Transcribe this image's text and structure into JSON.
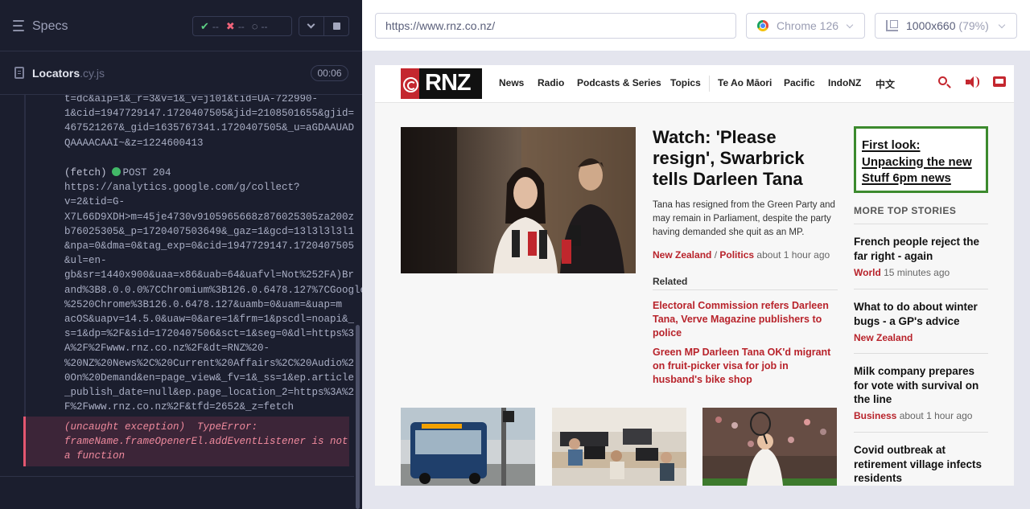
{
  "runner": {
    "title": "Specs",
    "stats": {
      "passed": "--",
      "failed": "--",
      "pending": "--"
    },
    "spec": {
      "name": "Locators",
      "ext": ".cy.js",
      "duration": "00:06"
    },
    "log_top": "t=dc&aip=1&_r=3&v=1&_v=j101&tid=UA-722990-\n1&cid=1947729147.1720407505&jid=2108501655&gjid=\n467521267&_gid=1635767341.1720407505&_u=aGDAAUAD\nQAAAACAAI~&z=1224600413",
    "fetch_tag": "(fetch)",
    "fetch_status": "POST 204",
    "fetch_url": "https://analytics.google.com/g/collect?\nv=2&tid=G-\nX7L66D9XDH>m=45je4730v9105965668z876025305za200z\nb76025305&_p=1720407503649&_gaz=1&gcd=13l3l3l3l1\n&npa=0&dma=0&tag_exp=0&cid=1947729147.1720407505\n&ul=en-\ngb&sr=1440x900&uaa=x86&uab=64&uafvl=Not%252FA)Br\nand%3B8.0.0.0%7CChromium%3B126.0.6478.127%7CGoogle\n%2520Chrome%3B126.0.6478.127&uamb=0&uam=&uap=m\nacOS&uapv=14.5.0&uaw=0&are=1&frm=1&pscdl=noapi&_\ns=1&dp=%2F&sid=1720407506&sct=1&seg=0&dl=https%3\nA%2F%2Fwww.rnz.co.nz%2F&dt=RNZ%20-\n%20NZ%20News%2C%20Current%20Affairs%2C%20Audio%2\n0On%20Demand&en=page_view&_fv=1&_ss=1&ep.article\n_publish_date=null&ep.page_location_2=https%3A%2\nF%2Fwww.rnz.co.nz%2F&tfd=2652&_z=fetch",
    "error": "(uncaught exception)  TypeError:\nframeName.frameOpenerEl.addEventListener is not\na function"
  },
  "aut": {
    "url": "https://www.rnz.co.nz/",
    "browser": "Chrome 126",
    "viewport": "1000x660",
    "zoom": "(79%)"
  },
  "site": {
    "logo": "RNZ",
    "nav": [
      "News",
      "Radio",
      "Podcasts & Series",
      "Topics",
      "Te Ao Māori",
      "Pacific",
      "IndoNZ",
      "中文"
    ],
    "lead": {
      "headline": "Watch: 'Please resign', Swarbrick tells Darleen Tana",
      "standfirst": "Tana has resigned from the Green Party and may remain in Parliament, despite the party having demanded she quit as an MP.",
      "section": "New Zealand",
      "sep": "/",
      "topic": "Politics",
      "ago": "about 1 hour ago",
      "related_label": "Related",
      "related": [
        "Electoral Commission refers Darleen Tana, Verve Magazine publishers to police",
        "Green MP Darleen Tana OK'd migrant on fruit-picker visa for job in husband's bike shop"
      ]
    },
    "first_look": "First look: Unpacking the new Stuff 6pm news",
    "more_top": "MORE TOP STORIES",
    "side": [
      {
        "title": "French people reject the far right - again",
        "section": "World",
        "ago": "15 minutes ago"
      },
      {
        "title": "What to do about winter bugs - a GP's advice",
        "section": "New Zealand",
        "ago": ""
      },
      {
        "title": "Milk company prepares for vote with survival on the line",
        "section": "Business",
        "ago": "about 1 hour ago"
      },
      {
        "title": "Covid outbreak at retirement village infects residents",
        "section": "",
        "ago": ""
      }
    ]
  },
  "colors": {
    "runner_bg": "#1b1e2e",
    "rnz_red": "#b8232b",
    "error": "#e45770",
    "pass": "#5dcf84"
  }
}
